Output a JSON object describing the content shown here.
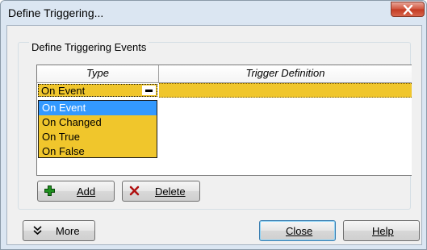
{
  "window": {
    "title": "Define Triggering..."
  },
  "group": {
    "label": "Define Triggering Events"
  },
  "grid": {
    "columns": [
      "Type",
      "Trigger Definition"
    ],
    "current_type": "On Event"
  },
  "dropdown": {
    "options": [
      "On Event",
      "On Changed",
      "On True",
      "On False"
    ],
    "selected": "On Event"
  },
  "buttons": {
    "add_label": "Add",
    "delete_label": "Delete",
    "more_label": "More",
    "close_label": "Close",
    "help_label": "Help"
  },
  "icons": {
    "add": "green-plus-icon",
    "delete": "red-x-icon",
    "more": "double-chevron-down-icon",
    "close": "close-icon"
  },
  "colors": {
    "row_highlight": "#f0c62c",
    "selection": "#3399ff",
    "add_icon": "#1f8f1f",
    "delete_icon": "#b01010"
  }
}
